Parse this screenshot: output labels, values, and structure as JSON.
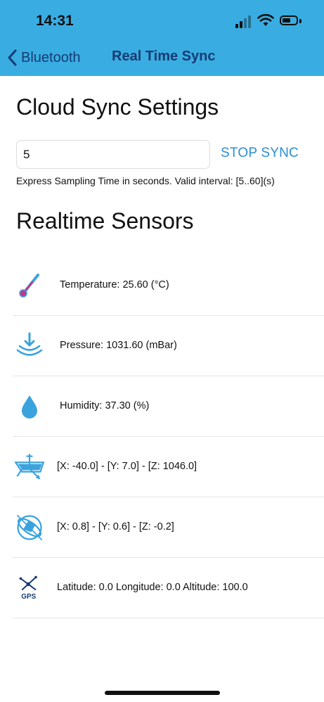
{
  "status_bar": {
    "time": "14:31"
  },
  "nav": {
    "back_label": "Bluetooth",
    "title": "Real Time Sync"
  },
  "cloud_sync": {
    "heading": "Cloud Sync Settings",
    "interval_value": "5",
    "stop_button": "STOP SYNC",
    "helper_text": "Express Sampling Time in seconds. Valid interval: [5..60](s)"
  },
  "sensors": {
    "heading": "Realtime Sensors",
    "items": [
      {
        "icon": "thermometer-icon",
        "text": "Temperature:  25.60 (°C)"
      },
      {
        "icon": "pressure-icon",
        "text": "Pressure:  1031.60 (mBar)"
      },
      {
        "icon": "humidity-drop-icon",
        "text": "Humidity:  37.30 (%)"
      },
      {
        "icon": "accelerometer-icon",
        "text": "[X: -40.0] - [Y: 7.0] - [Z: 1046.0]"
      },
      {
        "icon": "gyroscope-icon",
        "text": "[X: 0.8] - [Y: 0.6] - [Z: -0.2]"
      },
      {
        "icon": "gps-icon",
        "text": "Latitude: 0.0 Longitude: 0.0 Altitude: 100.0",
        "icon_label": "GPS"
      }
    ]
  },
  "colors": {
    "header": "#39ade2",
    "accent": "#2a8fd6",
    "nav_text": "#163b73"
  }
}
